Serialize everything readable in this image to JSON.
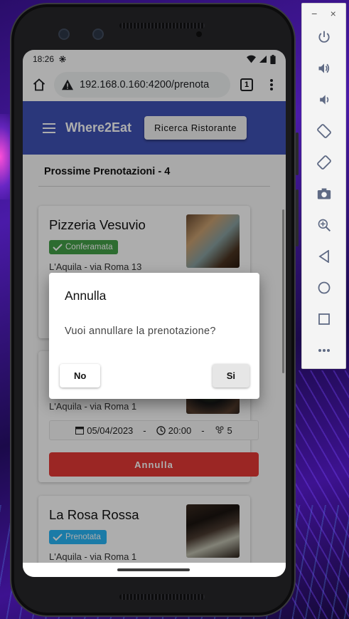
{
  "status": {
    "time": "18:26",
    "settings_icon": "gear-icon",
    "wifi_icon": "wifi-icon",
    "signal_icon": "signal-icon",
    "battery_icon": "battery-icon"
  },
  "browser": {
    "url": "192.168.0.160:4200/prenota",
    "tab_count": "1",
    "home_icon": "home-icon",
    "warning_icon": "warning-icon",
    "menu_icon": "more-vert-icon"
  },
  "appbar": {
    "title": "Where2Eat",
    "search_button": "Ricerca Ristorante",
    "background_color": "#3f51b5"
  },
  "section": {
    "title": "Prossime Prenotazioni - 4"
  },
  "cards": [
    {
      "name": "Pizzeria Vesuvio",
      "status": "Conferamata",
      "status_color": "#43a047",
      "address": "L'Aquila - via Roma 13"
    },
    {
      "name": "",
      "status": "",
      "address": "L'Aquila - via Roma 1",
      "date": "05/04/2023",
      "separator": "-",
      "time": "20:00",
      "guests": "5",
      "cancel_label": "Annulla",
      "cancel_color": "#e53935"
    },
    {
      "name": "La Rosa Rossa",
      "status": "Prenotata",
      "status_color": "#29b6f6",
      "address": "L'Aquila - via Roma 1"
    }
  ],
  "dialog": {
    "title": "Annulla",
    "message": "Vuoi annullare la prenotazione?",
    "no_label": "No",
    "yes_label": "Si"
  },
  "emulator_panel": {
    "minimize": "−",
    "close": "×",
    "controls": [
      "power-icon",
      "volume-up-icon",
      "volume-down-icon",
      "rotate-left-icon",
      "rotate-right-icon",
      "camera-icon",
      "zoom-icon",
      "back-icon",
      "home-circle-icon",
      "overview-icon",
      "more-icon"
    ]
  }
}
